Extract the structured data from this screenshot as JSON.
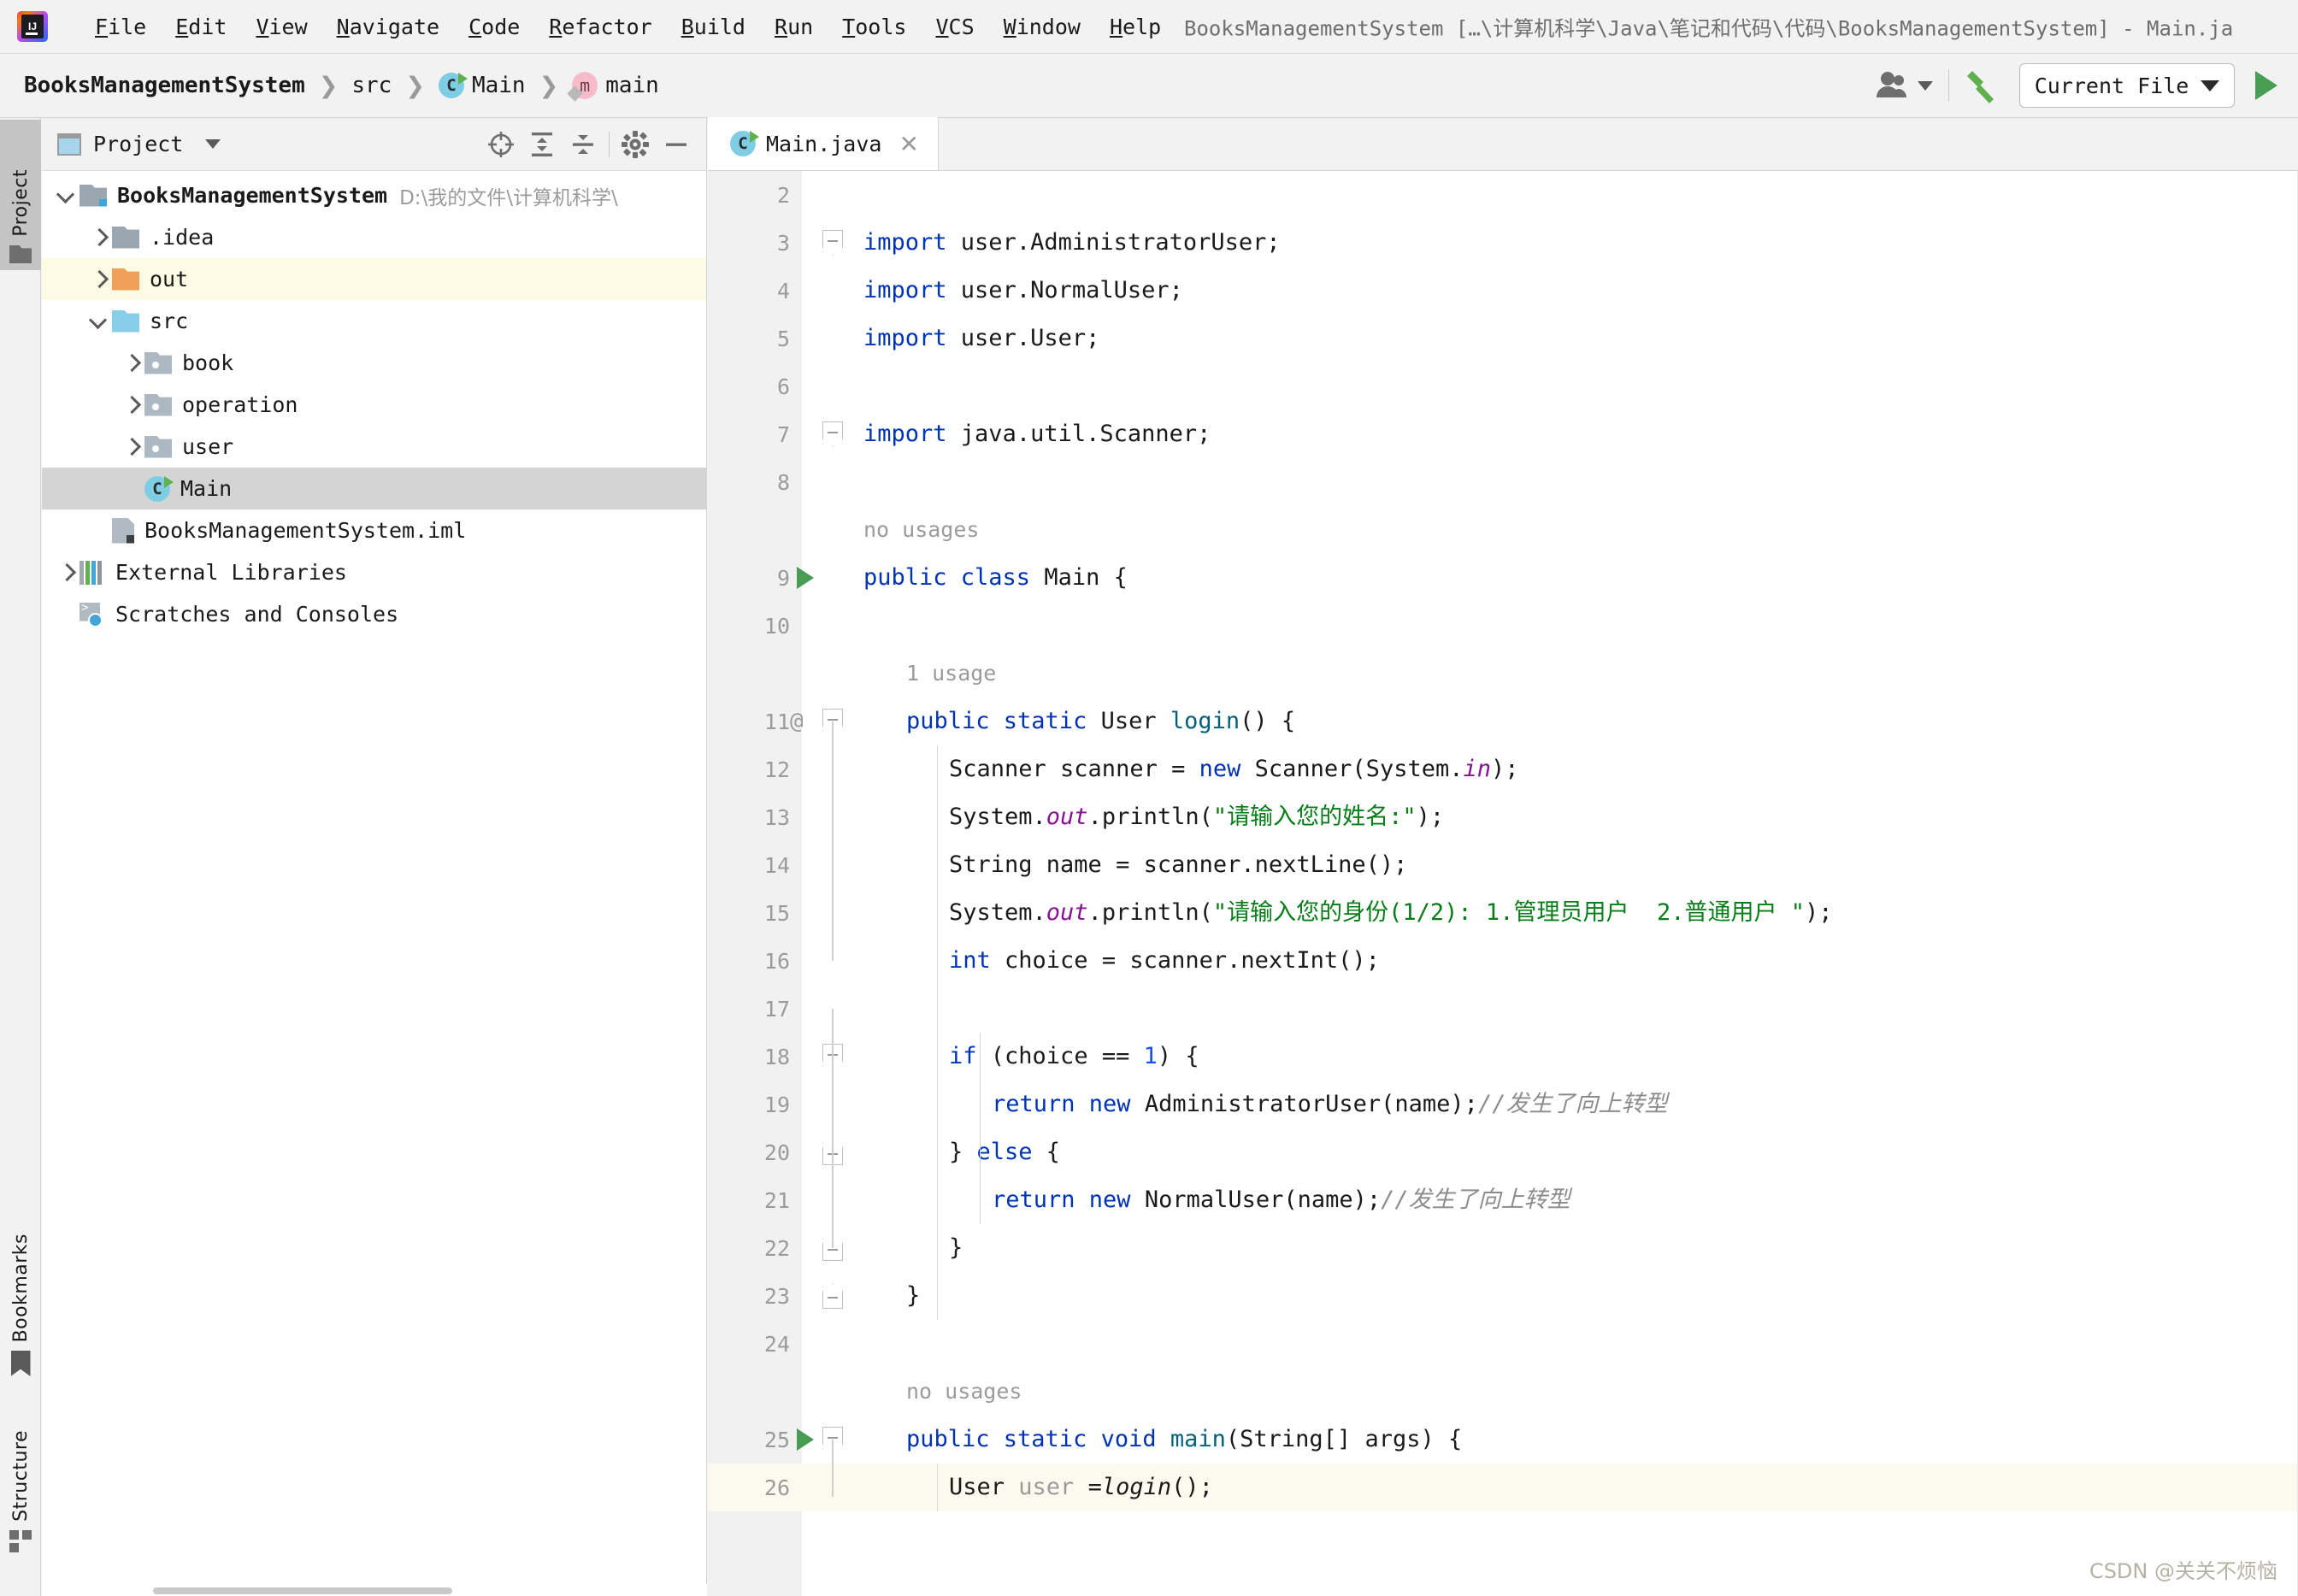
{
  "titlebar": {
    "logo_name": "intellij-idea-logo",
    "title": "BooksManagementSystem […\\计算机科学\\Java\\笔记和代码\\代码\\BooksManagementSystem] - Main.ja",
    "menus": [
      {
        "label": "File",
        "mnemonic": "F"
      },
      {
        "label": "Edit",
        "mnemonic": "E"
      },
      {
        "label": "View",
        "mnemonic": "V"
      },
      {
        "label": "Navigate",
        "mnemonic": "N"
      },
      {
        "label": "Code",
        "mnemonic": "C"
      },
      {
        "label": "Refactor",
        "mnemonic": "R"
      },
      {
        "label": "Build",
        "mnemonic": "B"
      },
      {
        "label": "Run",
        "mnemonic": "R"
      },
      {
        "label": "Tools",
        "mnemonic": "T"
      },
      {
        "label": "VCS",
        "mnemonic": "V"
      },
      {
        "label": "Window",
        "mnemonic": "W"
      },
      {
        "label": "Help",
        "mnemonic": "H"
      }
    ]
  },
  "navbar": {
    "breadcrumbs": [
      {
        "label": "BooksManagementSystem",
        "icon": "none",
        "bold": true
      },
      {
        "label": "src",
        "icon": "none",
        "bold": false
      },
      {
        "label": "Main",
        "icon": "class-icon",
        "bold": false
      },
      {
        "label": "main",
        "icon": "method-icon",
        "bold": false
      }
    ],
    "separator": "❯",
    "run_config": "Current File",
    "accent_green": "#499c54"
  },
  "left_tool_tabs": [
    {
      "label": "Project",
      "icon": "folder-icon",
      "active": true
    },
    {
      "label": "Bookmarks",
      "icon": "bookmark-icon",
      "active": false
    },
    {
      "label": "Structure",
      "icon": "structure-icon",
      "active": false
    }
  ],
  "project_panel": {
    "title": "Project",
    "tools": [
      "locate-icon",
      "expand-all-icon",
      "collapse-all-icon",
      "gear-icon",
      "hide-icon"
    ],
    "tree": [
      {
        "label": "BooksManagementSystem",
        "path": "D:\\我的文件\\计算机科学\\",
        "indent": 0,
        "arrow": "open",
        "icon": "module-folder",
        "bold": true,
        "state": "normal"
      },
      {
        "label": ".idea",
        "path": "",
        "indent": 1,
        "arrow": "closed",
        "icon": "folder",
        "bold": false,
        "state": "normal"
      },
      {
        "label": "out",
        "path": "",
        "indent": 1,
        "arrow": "closed",
        "icon": "folder-out",
        "bold": false,
        "state": "highlight"
      },
      {
        "label": "src",
        "path": "",
        "indent": 1,
        "arrow": "open",
        "icon": "folder-src",
        "bold": false,
        "state": "normal"
      },
      {
        "label": "book",
        "path": "",
        "indent": 2,
        "arrow": "closed",
        "icon": "folder-pkg",
        "bold": false,
        "state": "normal"
      },
      {
        "label": "operation",
        "path": "",
        "indent": 2,
        "arrow": "closed",
        "icon": "folder-pkg",
        "bold": false,
        "state": "normal"
      },
      {
        "label": "user",
        "path": "",
        "indent": 2,
        "arrow": "closed",
        "icon": "folder-pkg",
        "bold": false,
        "state": "normal"
      },
      {
        "label": "Main",
        "path": "",
        "indent": 2,
        "arrow": "none",
        "icon": "class-icon",
        "bold": false,
        "state": "selected"
      },
      {
        "label": "BooksManagementSystem.iml",
        "path": "",
        "indent": 1,
        "arrow": "none",
        "icon": "iml-icon",
        "bold": false,
        "state": "normal"
      },
      {
        "label": "External Libraries",
        "path": "",
        "indent": 0,
        "arrow": "closed",
        "icon": "library-icon",
        "bold": false,
        "state": "normal"
      },
      {
        "label": "Scratches and Consoles",
        "path": "",
        "indent": 0,
        "arrow": "none",
        "icon": "scratches-icon",
        "bold": false,
        "state": "normal"
      }
    ]
  },
  "editor": {
    "tab": {
      "label": "Main.java",
      "icon": "class-icon",
      "close": "✕"
    },
    "watermark": "CSDN @关关不烦恼",
    "lines": [
      {
        "num": "2",
        "indent": 0,
        "type": "code",
        "segments": [],
        "fold": "",
        "gutter": ""
      },
      {
        "num": "3",
        "indent": 0,
        "type": "code",
        "fold": "top",
        "gutter": "",
        "segments": [
          {
            "t": "import ",
            "c": "kw"
          },
          {
            "t": "user.AdministratorUser;",
            "c": ""
          }
        ]
      },
      {
        "num": "4",
        "indent": 0,
        "type": "code",
        "fold": "",
        "gutter": "",
        "segments": [
          {
            "t": "import ",
            "c": "kw"
          },
          {
            "t": "user.NormalUser;",
            "c": ""
          }
        ]
      },
      {
        "num": "5",
        "indent": 0,
        "type": "code",
        "fold": "",
        "gutter": "",
        "segments": [
          {
            "t": "import ",
            "c": "kw"
          },
          {
            "t": "user.User;",
            "c": ""
          }
        ]
      },
      {
        "num": "6",
        "indent": 0,
        "type": "code",
        "fold": "",
        "gutter": "",
        "segments": []
      },
      {
        "num": "7",
        "indent": 0,
        "type": "code",
        "fold": "top",
        "gutter": "",
        "segments": [
          {
            "t": "import ",
            "c": "kw"
          },
          {
            "t": "java.util.Scanner;",
            "c": ""
          }
        ]
      },
      {
        "num": "8",
        "indent": 0,
        "type": "code",
        "fold": "",
        "gutter": "",
        "segments": []
      },
      {
        "num": "",
        "indent": 0,
        "type": "hint",
        "text": "no usages"
      },
      {
        "num": "9",
        "indent": 0,
        "type": "code",
        "fold": "",
        "gutter": "run",
        "segments": [
          {
            "t": "public class ",
            "c": "kw"
          },
          {
            "t": "Main ",
            "c": ""
          },
          {
            "t": "{",
            "c": ""
          }
        ]
      },
      {
        "num": "10",
        "indent": 0,
        "type": "code",
        "fold": "",
        "gutter": "",
        "segments": []
      },
      {
        "num": "",
        "indent": 1,
        "type": "hint",
        "text": "1 usage"
      },
      {
        "num": "11",
        "indent": 1,
        "type": "code",
        "fold": "top",
        "gutter": "at",
        "segments": [
          {
            "t": "public static ",
            "c": "kw"
          },
          {
            "t": "User ",
            "c": ""
          },
          {
            "t": "login",
            "c": "mth"
          },
          {
            "t": "() {",
            "c": ""
          }
        ]
      },
      {
        "num": "12",
        "indent": 2,
        "type": "code",
        "fold": "",
        "gutter": "",
        "segments": [
          {
            "t": "Scanner scanner = ",
            "c": ""
          },
          {
            "t": "new ",
            "c": "kw"
          },
          {
            "t": "Scanner(System.",
            "c": ""
          },
          {
            "t": "in",
            "c": "fld"
          },
          {
            "t": ");",
            "c": ""
          }
        ]
      },
      {
        "num": "13",
        "indent": 2,
        "type": "code",
        "fold": "",
        "gutter": "",
        "segments": [
          {
            "t": "System.",
            "c": ""
          },
          {
            "t": "out",
            "c": "fld"
          },
          {
            "t": ".println(",
            "c": ""
          },
          {
            "t": "\"请输入您的姓名:\"",
            "c": "str"
          },
          {
            "t": ");",
            "c": ""
          }
        ]
      },
      {
        "num": "14",
        "indent": 2,
        "type": "code",
        "fold": "",
        "gutter": "",
        "segments": [
          {
            "t": "String name = scanner.nextLine();",
            "c": ""
          }
        ]
      },
      {
        "num": "15",
        "indent": 2,
        "type": "code",
        "fold": "",
        "gutter": "",
        "segments": [
          {
            "t": "System.",
            "c": ""
          },
          {
            "t": "out",
            "c": "fld"
          },
          {
            "t": ".println(",
            "c": ""
          },
          {
            "t": "\"请输入您的身份(1/2): 1.管理员用户  2.普通用户 \"",
            "c": "str"
          },
          {
            "t": ");",
            "c": ""
          }
        ]
      },
      {
        "num": "16",
        "indent": 2,
        "type": "code",
        "fold": "",
        "gutter": "",
        "segments": [
          {
            "t": "int ",
            "c": "kw"
          },
          {
            "t": "choice = scanner.nextInt();",
            "c": ""
          }
        ]
      },
      {
        "num": "17",
        "indent": 0,
        "type": "code",
        "fold": "",
        "gutter": "",
        "segments": []
      },
      {
        "num": "18",
        "indent": 2,
        "type": "code",
        "fold": "top",
        "gutter": "",
        "segments": [
          {
            "t": "if ",
            "c": "kw"
          },
          {
            "t": "(choice == ",
            "c": ""
          },
          {
            "t": "1",
            "c": "num"
          },
          {
            "t": ") {",
            "c": ""
          }
        ]
      },
      {
        "num": "19",
        "indent": 3,
        "type": "code",
        "fold": "",
        "gutter": "",
        "segments": [
          {
            "t": "return new ",
            "c": "kw"
          },
          {
            "t": "AdministratorUser(name);",
            "c": ""
          },
          {
            "t": "//发生了向上转型",
            "c": "cmt"
          }
        ]
      },
      {
        "num": "20",
        "indent": 2,
        "type": "code",
        "fold": "btm",
        "gutter": "",
        "segments": [
          {
            "t": "} ",
            "c": ""
          },
          {
            "t": "else ",
            "c": "kw"
          },
          {
            "t": "{",
            "c": ""
          }
        ]
      },
      {
        "num": "21",
        "indent": 3,
        "type": "code",
        "fold": "",
        "gutter": "",
        "segments": [
          {
            "t": "return new ",
            "c": "kw"
          },
          {
            "t": "NormalUser(name);",
            "c": ""
          },
          {
            "t": "//发生了向上转型",
            "c": "cmt"
          }
        ]
      },
      {
        "num": "22",
        "indent": 2,
        "type": "code",
        "fold": "btm",
        "gutter": "",
        "segments": [
          {
            "t": "}",
            "c": ""
          }
        ]
      },
      {
        "num": "23",
        "indent": 1,
        "type": "code",
        "fold": "btm",
        "gutter": "",
        "segments": [
          {
            "t": "}",
            "c": ""
          }
        ]
      },
      {
        "num": "24",
        "indent": 0,
        "type": "code",
        "fold": "",
        "gutter": "",
        "segments": []
      },
      {
        "num": "",
        "indent": 1,
        "type": "hint",
        "text": "no usages"
      },
      {
        "num": "25",
        "indent": 1,
        "type": "code",
        "fold": "top",
        "gutter": "run",
        "segments": [
          {
            "t": "public static void ",
            "c": "kw"
          },
          {
            "t": "main",
            "c": "mth"
          },
          {
            "t": "(String[] args) {",
            "c": ""
          }
        ]
      },
      {
        "num": "26",
        "indent": 2,
        "type": "code",
        "fold": "",
        "gutter": "",
        "current": true,
        "segments": [
          {
            "t": "User ",
            "c": ""
          },
          {
            "t": "user ",
            "c": "gray"
          },
          {
            "t": "=",
            "c": ""
          },
          {
            "t": "login",
            "c": "mth-i"
          },
          {
            "t": "();",
            "c": ""
          }
        ]
      }
    ]
  },
  "colors": {
    "keyword": "#0033b3",
    "string": "#067d17",
    "comment": "#8c8c8c",
    "field": "#871094",
    "method": "#00627a",
    "number": "#1750eb",
    "run_green": "#499c54",
    "selection": "#d4d4d4",
    "highlight_row": "#fdfbe4",
    "current_line": "#fcfaef"
  }
}
